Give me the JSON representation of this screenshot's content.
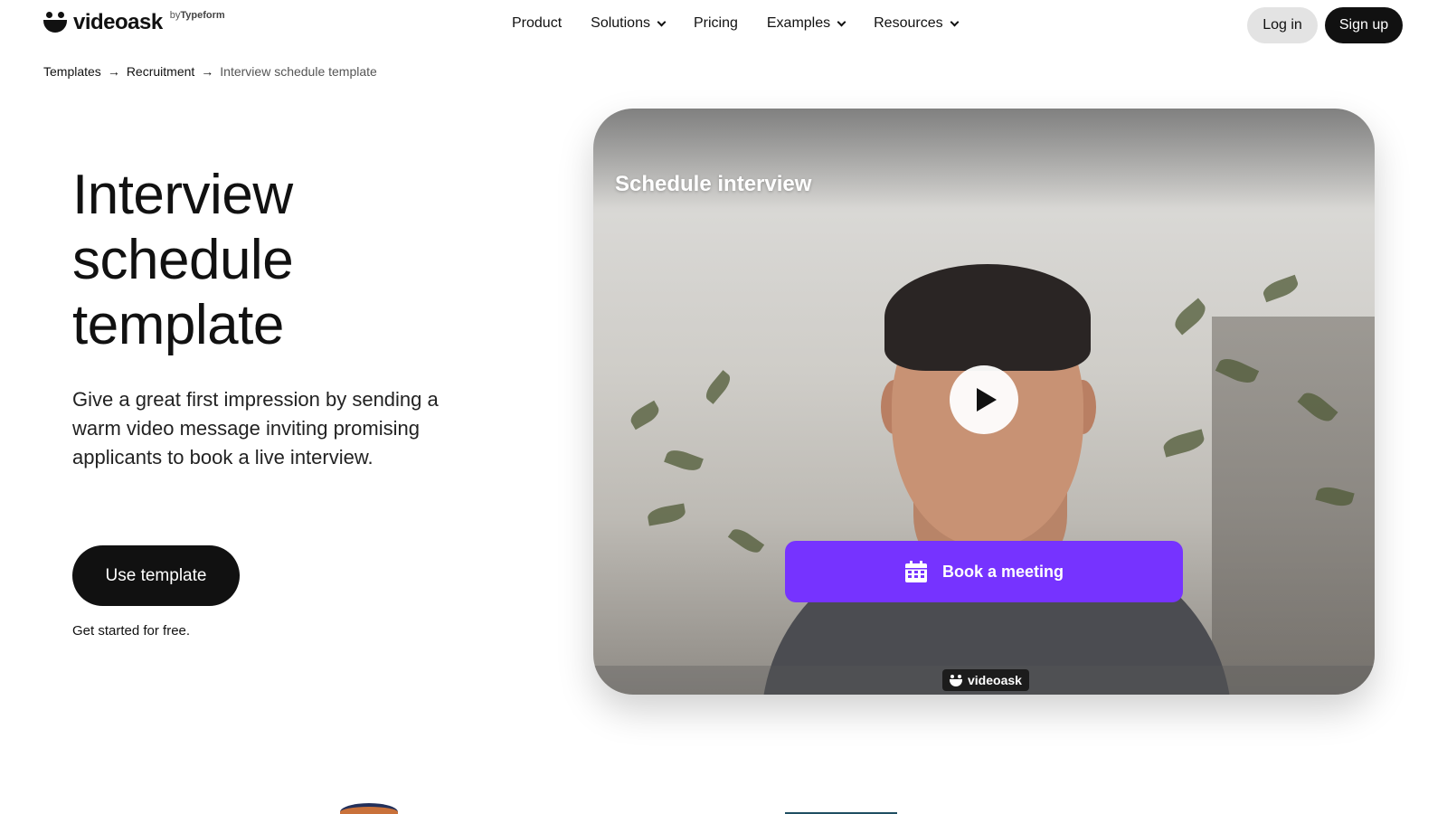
{
  "brand": {
    "name": "videoask",
    "by": "by",
    "by_name": "Typeform"
  },
  "nav": {
    "items": [
      {
        "label": "Product",
        "dropdown": false
      },
      {
        "label": "Solutions",
        "dropdown": true
      },
      {
        "label": "Pricing",
        "dropdown": false
      },
      {
        "label": "Examples",
        "dropdown": true
      },
      {
        "label": "Resources",
        "dropdown": true
      }
    ],
    "login_label": "Log in",
    "signup_label": "Sign up"
  },
  "breadcrumb": {
    "items": [
      "Templates",
      "Recruitment",
      "Interview schedule template"
    ],
    "separator": "→"
  },
  "hero": {
    "title_lines": [
      "Interview",
      "schedule",
      "template"
    ],
    "description": "Give a great first impression by sending a warm video message inviting promising applicants to book a live interview.",
    "cta_label": "Use template",
    "cta_note": "Get started for free."
  },
  "video": {
    "title": "Schedule interview",
    "book_label": "Book a meeting",
    "badge": "videoask",
    "colors": {
      "book_button": "#7633ff"
    }
  },
  "colors": {
    "text": "#111111",
    "login_bg": "#e3e3e3",
    "signup_bg": "#111111"
  }
}
